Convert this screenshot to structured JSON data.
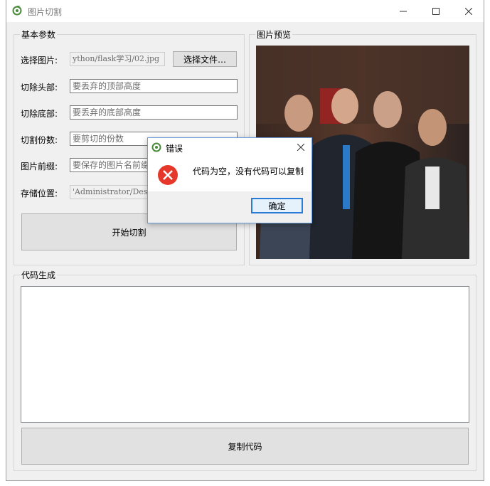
{
  "window": {
    "title": "图片切割"
  },
  "basic_group": {
    "title": "基本参数",
    "select_image": {
      "label": "选择图片:",
      "value": "ython/flask学习/02.jpg",
      "button": "选择文件…"
    },
    "cut_top": {
      "label": "切除头部:",
      "placeholder": "要丢弃的顶部高度"
    },
    "cut_bottom": {
      "label": "切除底部:",
      "placeholder": "要丢弃的底部高度"
    },
    "cut_count": {
      "label": "切割份数:",
      "placeholder": "要剪切的份数"
    },
    "prefix": {
      "label": "图片前缀:",
      "placeholder": "要保存的图片名前缀"
    },
    "save_path": {
      "label": "存储位置:",
      "value": "'Administrator/Desktop"
    },
    "start_button": "开始切割"
  },
  "preview_group": {
    "title": "图片预览"
  },
  "code_group": {
    "title": "代码生成",
    "code_text": "",
    "copy_button": "复制代码"
  },
  "dialog": {
    "title": "错误",
    "message": "代码为空，没有代码可以复制",
    "ok_button": "确定"
  },
  "colors": {
    "accent": "#6a9ad8",
    "error": "#e5382a",
    "window_bg": "#f0f0f0"
  }
}
